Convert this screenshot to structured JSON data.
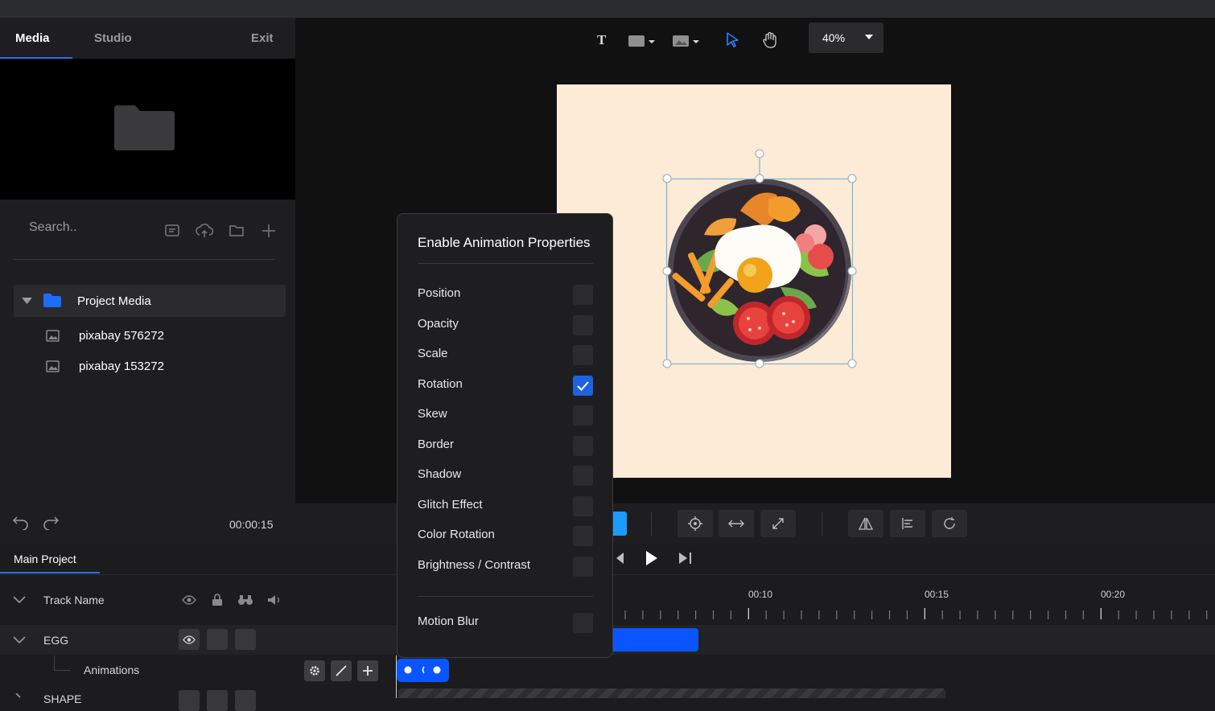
{
  "left_tabs": {
    "media": "Media",
    "studio": "Studio",
    "exit": "Exit"
  },
  "search": {
    "placeholder": "Search.."
  },
  "project_media": {
    "label": "Project Media",
    "files": [
      "pixabay 576272",
      "pixabay 153272"
    ]
  },
  "zoom": {
    "value": "40%"
  },
  "toolbar": {
    "text_tool": "T"
  },
  "time": "00:00:15",
  "timeline": {
    "tab": "Main Project",
    "track_name_header": "Track Name",
    "tracks": {
      "egg": "EGG",
      "animations": "Animations",
      "shape": "SHAPE"
    },
    "ruler": [
      "00:10",
      "00:15",
      "00:20"
    ]
  },
  "animation_popup": {
    "title": "Enable Animation Properties",
    "properties": [
      {
        "label": "Position",
        "checked": false
      },
      {
        "label": "Opacity",
        "checked": false
      },
      {
        "label": "Scale",
        "checked": false
      },
      {
        "label": "Rotation",
        "checked": true
      },
      {
        "label": "Skew",
        "checked": false
      },
      {
        "label": "Border",
        "checked": false
      },
      {
        "label": "Shadow",
        "checked": false
      },
      {
        "label": "Glitch Effect",
        "checked": false
      },
      {
        "label": "Color Rotation",
        "checked": false
      },
      {
        "label": "Brightness / Contrast",
        "checked": false
      }
    ],
    "motion_blur": {
      "label": "Motion Blur",
      "checked": false
    }
  },
  "colors": {
    "accent": "#1e62e0",
    "artboard": "#fbebd7",
    "clip": "#0a55ff"
  }
}
